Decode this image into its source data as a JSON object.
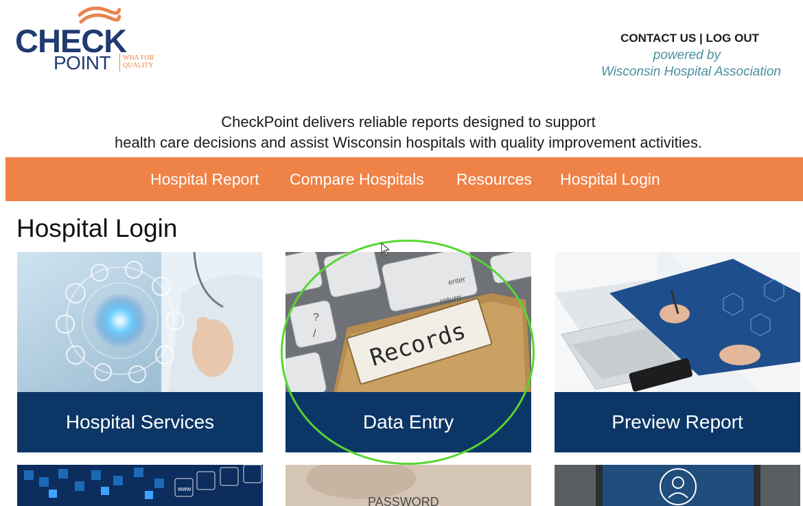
{
  "logo": {
    "line1": "CHECK",
    "line2": "POINT",
    "tag_line1": "WHA FOR",
    "tag_line2": "QUALITY"
  },
  "header": {
    "contact_us": "CONTACT US",
    "separator": "|",
    "log_out": "LOG OUT",
    "powered_by": "powered by",
    "association": "Wisconsin Hospital Association"
  },
  "tagline": {
    "line1": "CheckPoint delivers reliable reports designed to support",
    "line2": "health care decisions and assist Wisconsin hospitals with quality improvement activities."
  },
  "nav": {
    "items": [
      {
        "label": "Hospital Report"
      },
      {
        "label": "Compare Hospitals"
      },
      {
        "label": "Resources"
      },
      {
        "label": "Hospital Login"
      }
    ]
  },
  "page": {
    "title": "Hospital Login"
  },
  "tiles": [
    {
      "label": "Hospital Services",
      "icon": "medical-network-image"
    },
    {
      "label": "Data Entry",
      "icon": "records-folder-image",
      "image_text": "Records"
    },
    {
      "label": "Preview Report",
      "icon": "doctor-writing-report-image"
    }
  ],
  "tiles_partial": [
    {
      "icon": "web-icons-grid-image",
      "image_text": "www"
    },
    {
      "icon": "password-image",
      "image_text": "PASSWORD"
    },
    {
      "icon": "user-profile-image"
    }
  ],
  "colors": {
    "brand_navy": "#0c3666",
    "nav_orange": "#ef8247",
    "link_teal": "#4a8fa0",
    "highlight_green": "#56d72f"
  }
}
